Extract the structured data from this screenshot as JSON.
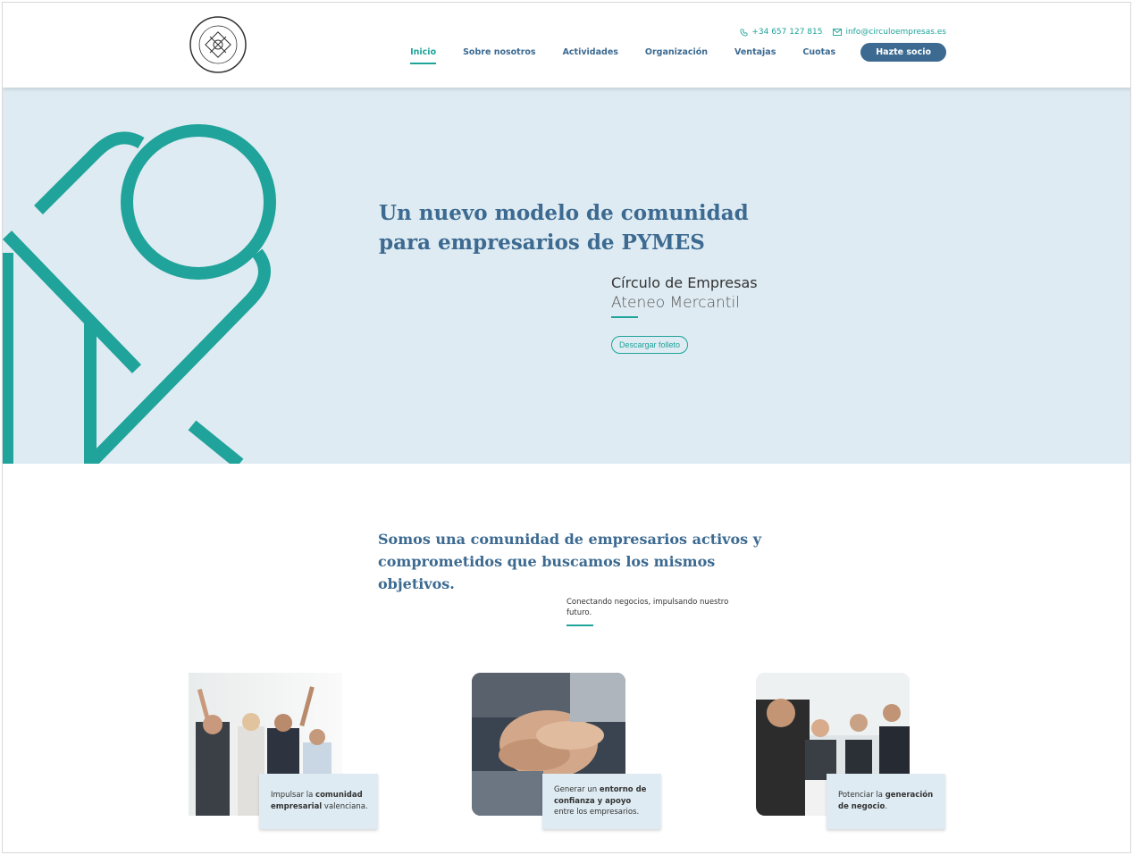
{
  "header": {
    "logo_alt": "Círculo de Empresas Ateneo Mercantil",
    "phone": "+34 657 127 815",
    "email": "info@circuloempresas.es",
    "nav": [
      {
        "label": "Inicio",
        "active": true
      },
      {
        "label": "Sobre nosotros"
      },
      {
        "label": "Actividades"
      },
      {
        "label": "Organización"
      },
      {
        "label": "Ventajas"
      },
      {
        "label": "Cuotas"
      }
    ],
    "cta_label": "Hazte socio"
  },
  "hero": {
    "title_line1": "Un nuevo modelo de comunidad",
    "title_line2": "para empresarios de PYMES",
    "subtitle_line1": "Círculo de Empresas",
    "subtitle_line2": "Ateneo Mercantil",
    "button_label": "Descargar folleto"
  },
  "intro": {
    "title": "Somos una comunidad de empresarios activos y comprometidos que buscamos los mismos objetivos.",
    "subtitle": "Conectando negocios, impulsando nuestro futuro."
  },
  "cards": [
    {
      "pre": "Impulsar la ",
      "bold": "comunidad empresarial",
      "post": " valenciana."
    },
    {
      "pre": "Generar un ",
      "bold": "entorno de confianza y apoyo",
      "post": " entre los empresarios."
    },
    {
      "pre": "Potenciar la ",
      "bold": "generación de negocio",
      "post": "."
    }
  ],
  "colors": {
    "teal": "#1fa39a",
    "blue": "#3c6a91",
    "hero_bg": "#deebf2"
  }
}
